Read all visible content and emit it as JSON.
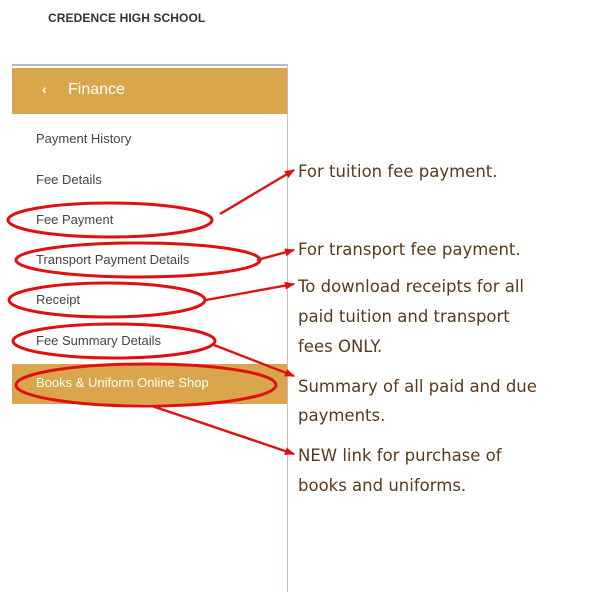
{
  "header": {
    "school_name": "CREDENCE HIGH SCHOOL"
  },
  "sidebar": {
    "section": {
      "chevron": "‹",
      "label": "Finance"
    },
    "items": [
      {
        "label": "Payment History"
      },
      {
        "label": "Fee Details"
      },
      {
        "label": "Fee Payment"
      },
      {
        "label": "Transport Payment Details"
      },
      {
        "label": "Receipt"
      },
      {
        "label": "Fee Summary Details"
      },
      {
        "label": "Books & Uniform Online Shop"
      }
    ]
  },
  "annotations": {
    "tuition": "For tuition fee payment.",
    "transport": "For transport fee payment.",
    "receipt": [
      "To download receipts for all",
      "paid tuition and transport",
      "fees ONLY."
    ],
    "summary": [
      "Summary of all paid and due",
      "payments."
    ],
    "shop": [
      "NEW link for purchase of",
      "books and uniforms."
    ]
  },
  "colors": {
    "accent_gold": "#d9a64c",
    "annotation_red": "#e01010",
    "annotation_text": "#5a3a1a"
  }
}
